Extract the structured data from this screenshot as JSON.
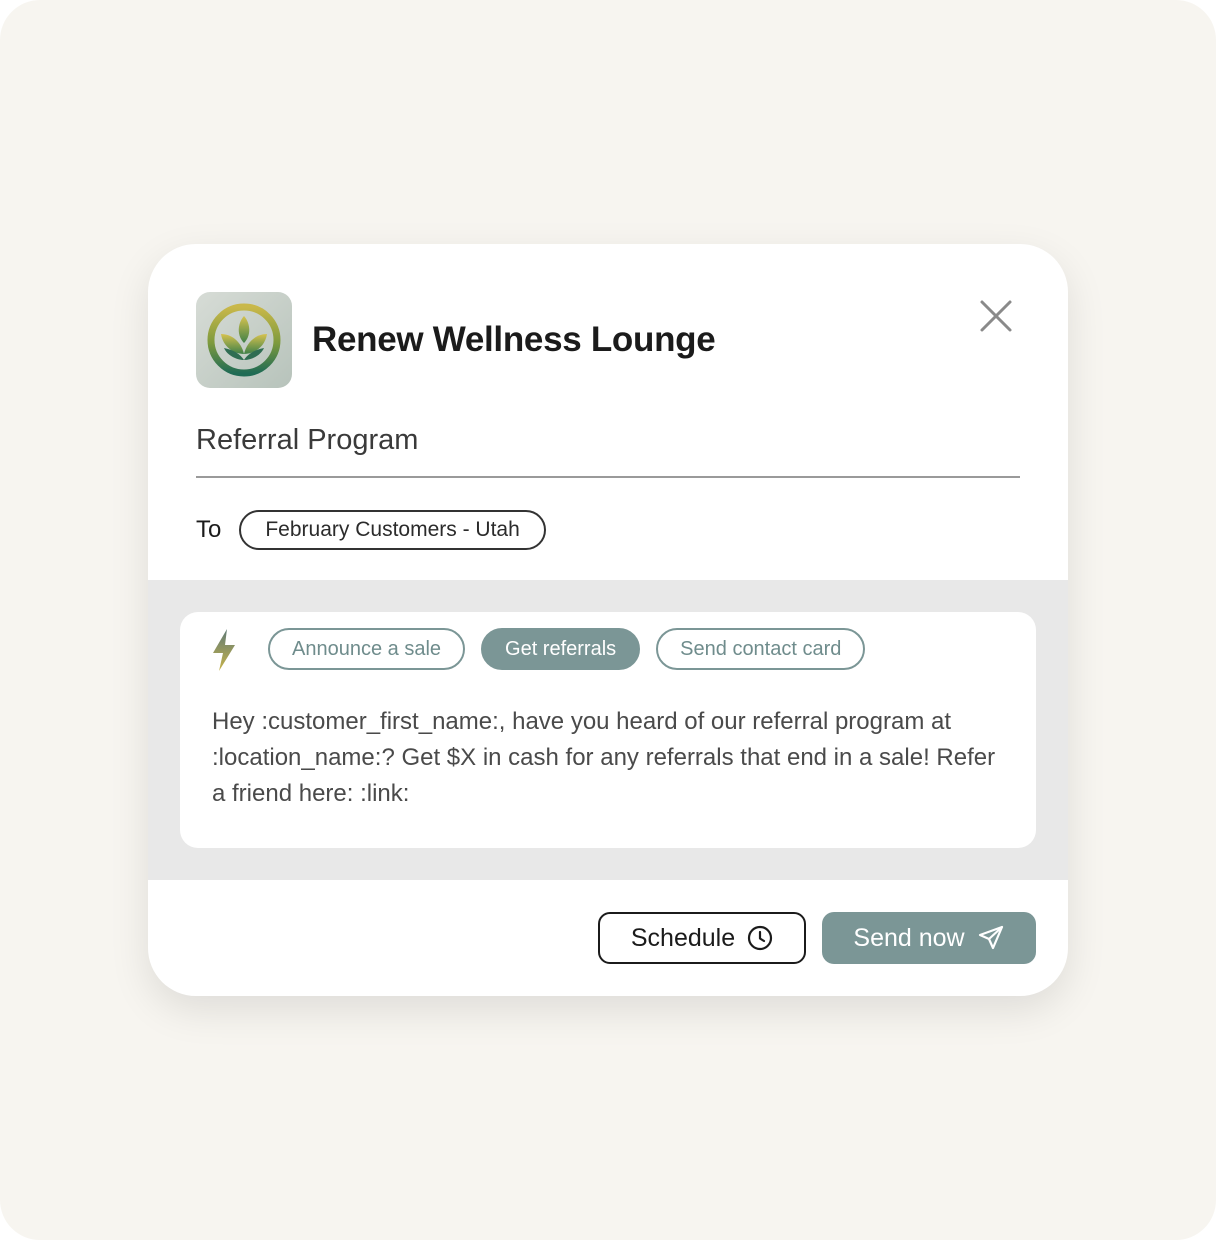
{
  "header": {
    "business_name": "Renew Wellness Lounge",
    "logo_icon": "lotus-leaf-logo",
    "close_icon": "close-icon"
  },
  "subject": {
    "value": "Referral Program"
  },
  "recipients": {
    "label": "To",
    "selected": "February Customers - Utah"
  },
  "templates": {
    "icon": "lightning-bolt-icon",
    "items": [
      {
        "label": "Announce a sale",
        "active": false
      },
      {
        "label": "Get referrals",
        "active": true
      },
      {
        "label": "Send contact card",
        "active": false
      }
    ]
  },
  "message": {
    "body": "Hey :customer_first_name:, have you heard of our referral program at :location_name:? Get $X in cash for any referrals that end in a sale! Refer a friend here: :link:"
  },
  "actions": {
    "schedule_label": "Schedule",
    "schedule_icon": "clock-icon",
    "send_label": "Send now",
    "send_icon": "paper-plane-icon"
  },
  "colors": {
    "accent": "#7b9696",
    "background": "#f7f5f0",
    "band": "#e8e8e8"
  }
}
